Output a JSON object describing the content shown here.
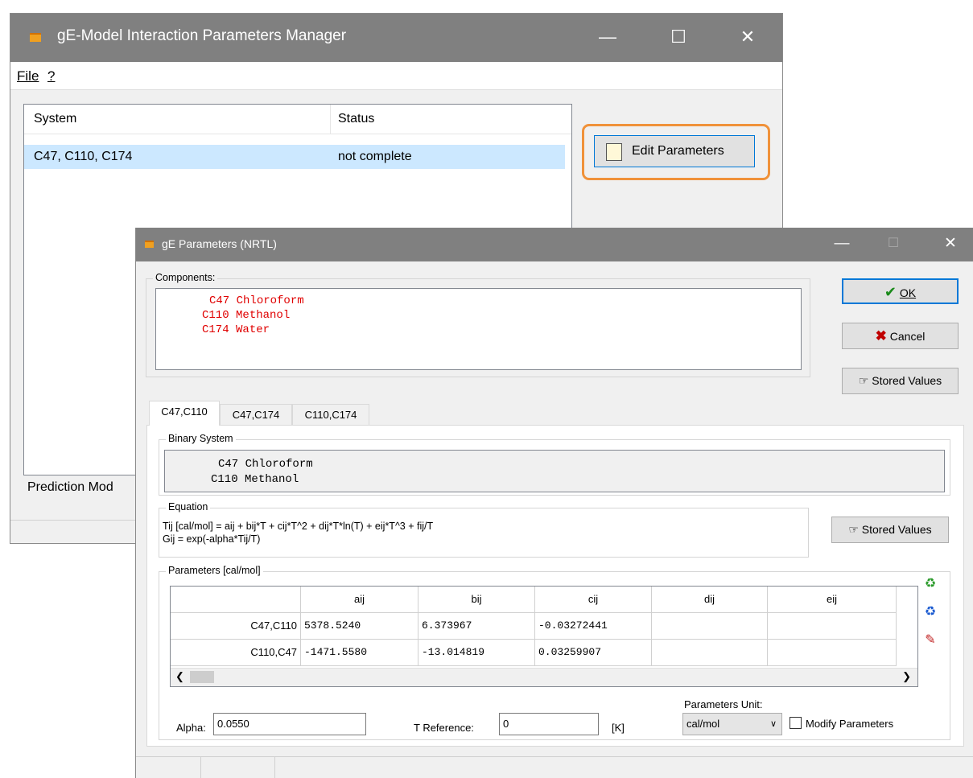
{
  "main_window": {
    "title": "gE-Model Interaction Parameters Manager",
    "menu": [
      {
        "label": "File"
      },
      {
        "label": "?"
      }
    ],
    "list": {
      "columns": [
        "System",
        "Status"
      ],
      "rows": [
        {
          "system": "C47, C110, C174",
          "status": "not complete"
        }
      ]
    },
    "edit_button_label": "Edit Parameters",
    "prediction_label": "Prediction Mod"
  },
  "dialog": {
    "title": "gE Parameters (NRTL)",
    "components_label": "Components:",
    "components": [
      {
        "id": "C47",
        "name": "Chloroform"
      },
      {
        "id": "C110",
        "name": "Methanol"
      },
      {
        "id": "C174",
        "name": "Water"
      }
    ],
    "buttons": {
      "ok": "OK",
      "cancel": "Cancel",
      "stored_values": "Stored Values",
      "stored_values_eq": "Stored Values"
    },
    "tabs": [
      {
        "label": "C47,C110"
      },
      {
        "label": "C47,C174"
      },
      {
        "label": "C110,C174"
      }
    ],
    "binary_system": {
      "label": "Binary System",
      "components": [
        {
          "id": "C47",
          "name": "Chloroform"
        },
        {
          "id": "C110",
          "name": "Methanol"
        }
      ]
    },
    "equation": {
      "label": "Equation",
      "line1": "Tij [cal/mol] = aij + bij*T + cij*T^2 + dij*T*ln(T) + eij*T^3 + fij/T",
      "line2": "Gij = exp(-alpha*Tij/T)"
    },
    "parameters": {
      "label": "Parameters [cal/mol]",
      "columns": [
        "aij",
        "bij",
        "cij",
        "dij",
        "eij"
      ],
      "rows": [
        {
          "pair": "C47,C110",
          "values": [
            "5378.5240",
            "6.373967",
            "-0.03272441",
            "",
            ""
          ]
        },
        {
          "pair": "C110,C47",
          "values": [
            "-1471.5580",
            "-13.014819",
            "0.03259907",
            "",
            ""
          ]
        }
      ]
    },
    "alpha": {
      "label": "Alpha:",
      "value": "0.0550"
    },
    "t_reference": {
      "label": "T Reference:",
      "value": "0",
      "unit": "[K]"
    },
    "parameters_unit": {
      "label": "Parameters Unit:",
      "selected": "cal/mol"
    },
    "modify_parameters": {
      "label": "Modify Parameters",
      "checked": false
    }
  },
  "colors": {
    "accent_orange": "#f0923a",
    "component_red": "#e00000",
    "selection_blue": "#cce8ff",
    "titlebar_gray": "#808080"
  }
}
